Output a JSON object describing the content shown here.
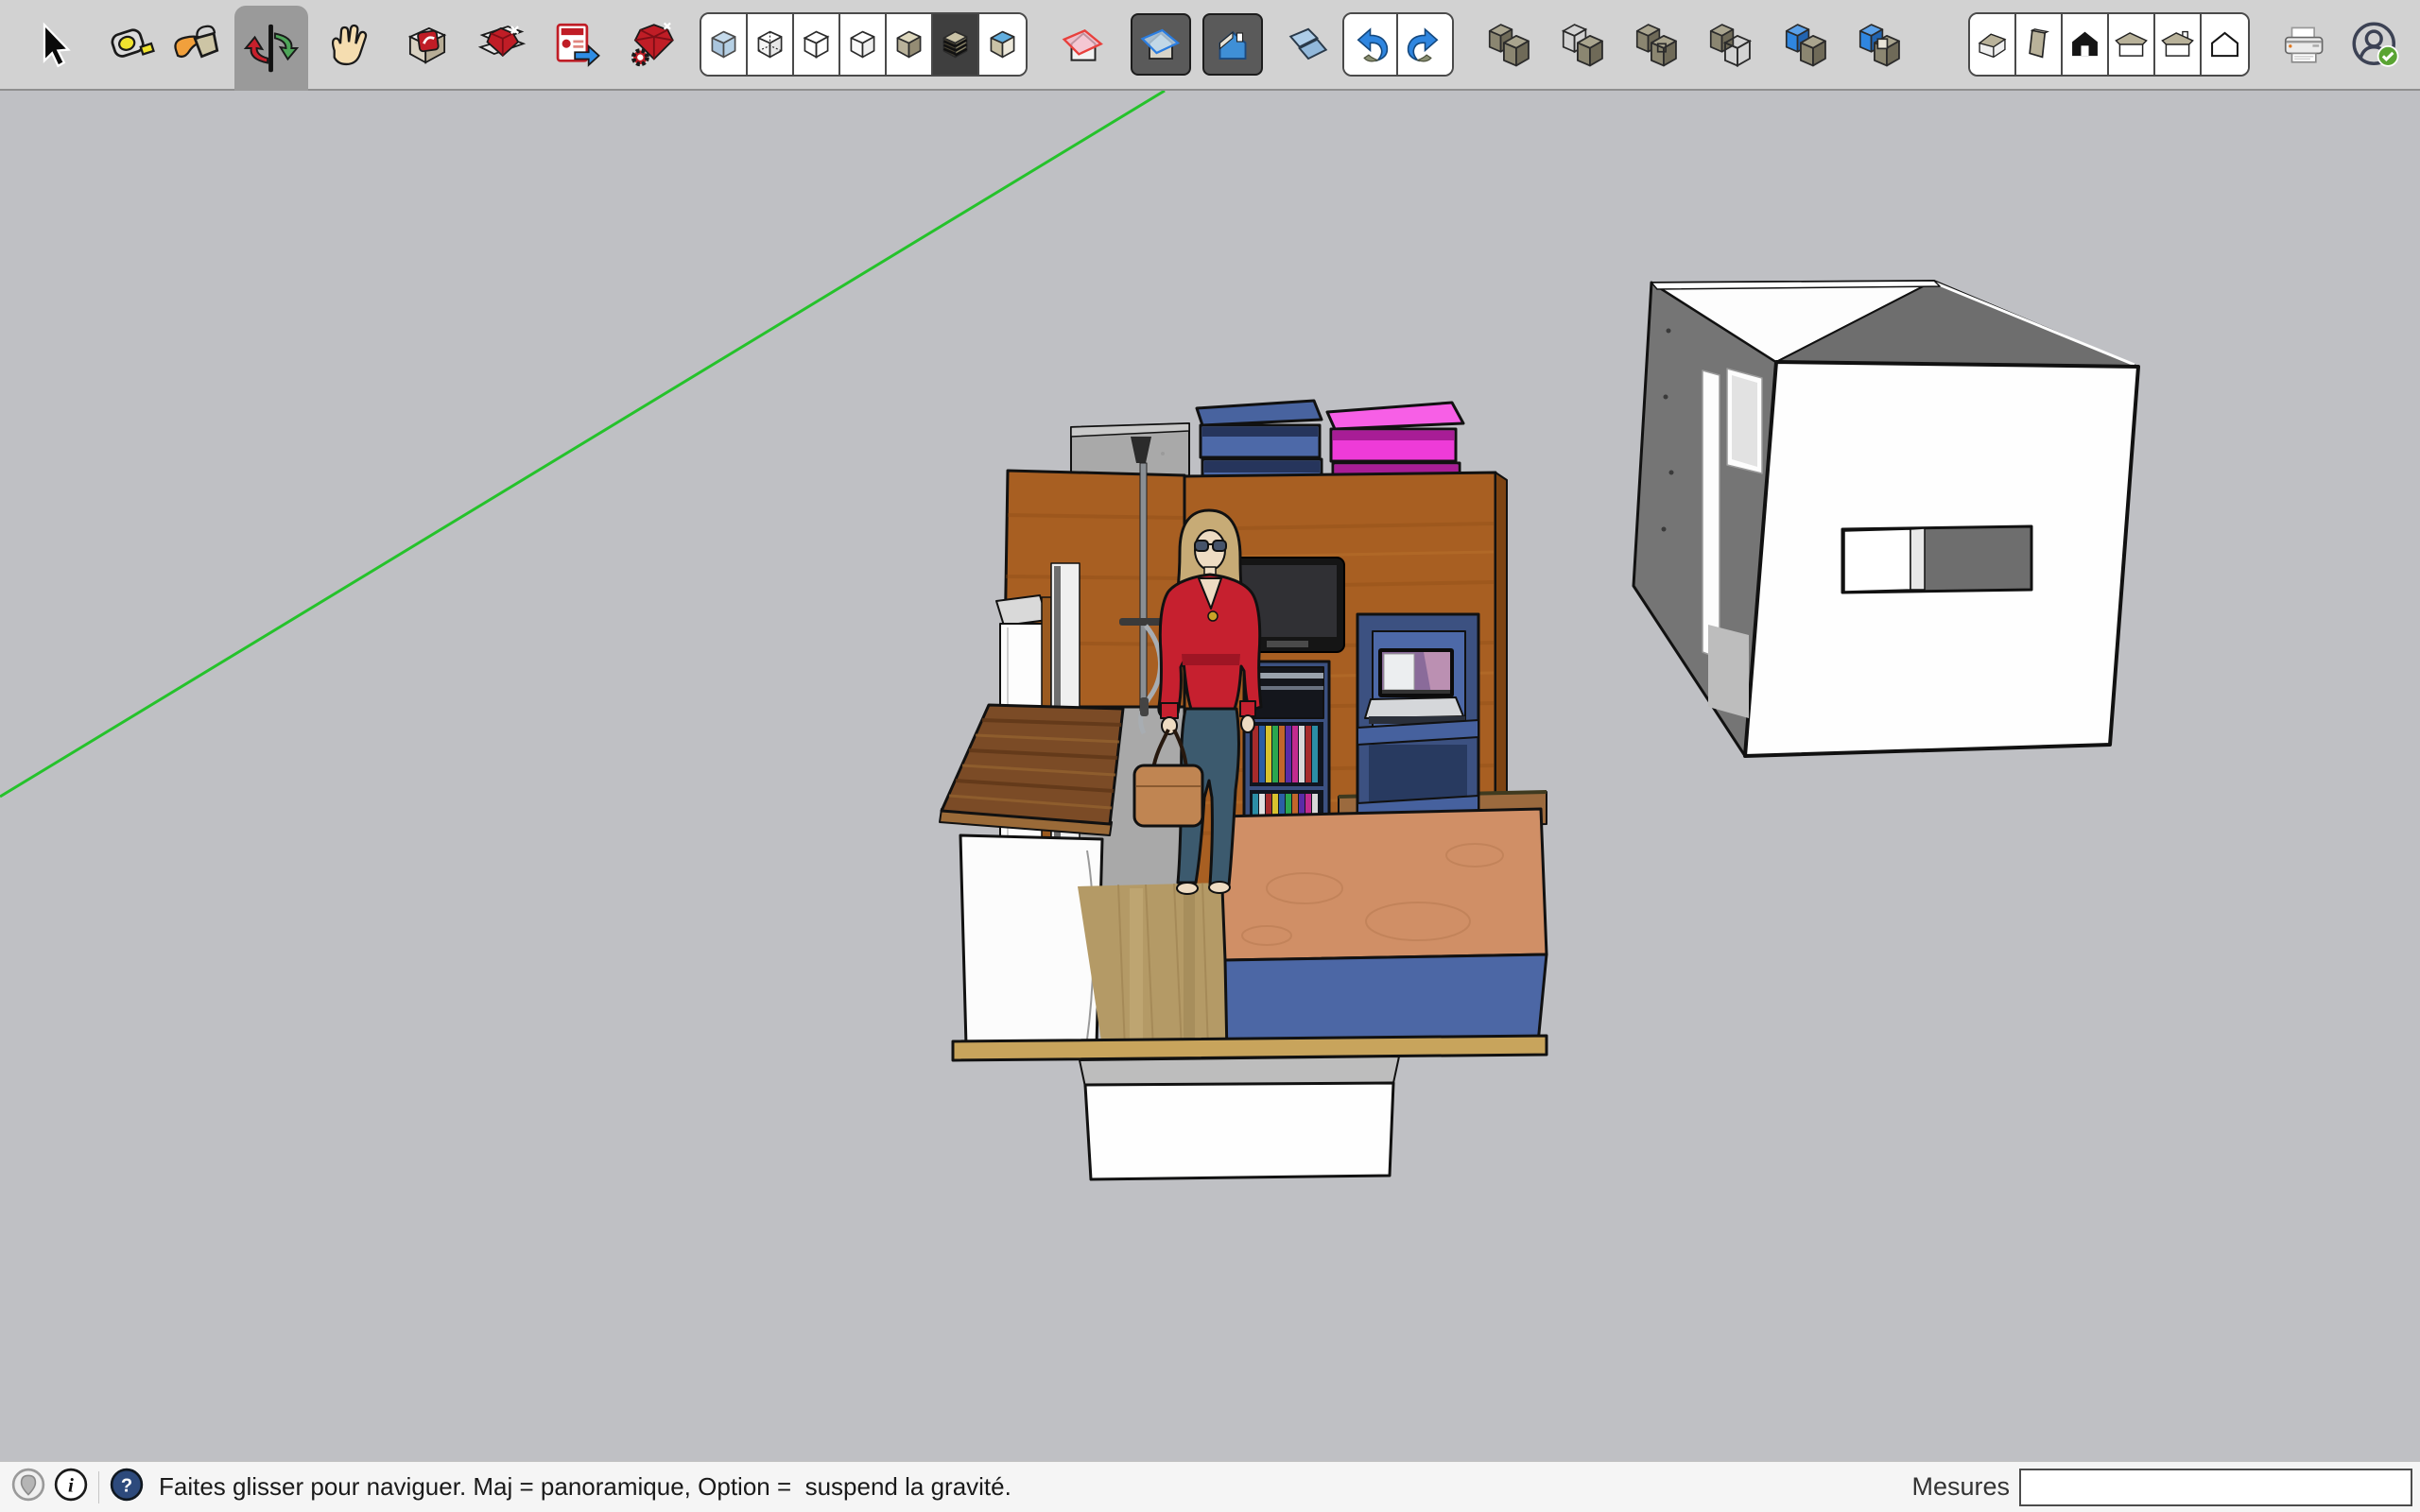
{
  "app": {
    "name": "SketchUp"
  },
  "colors": {
    "canvas": "#bfc0c4",
    "toolbar": "#d2d2d2",
    "green_axis": "#25c22b",
    "wood": "#a85f22",
    "wood_dark": "#7d4413",
    "gray_wall": "#a9a9a9",
    "navy": "#3c5181",
    "navy_light": "#4d69a8",
    "navy_dark": "#283a60",
    "pink": "#ee3bd8",
    "pink_top": "#f75fe6",
    "pink_dark": "#a81d96",
    "hair": "#c7ab76",
    "skin": "#eedcc3",
    "red_top": "#c6202f",
    "red_dark": "#9e1524",
    "jeans": "#3c5a6e",
    "bag": "#c08552",
    "counter_wood": "#7b4b26",
    "floor_wood": "#b49a66",
    "bed_wood": "#d08f66",
    "bed_blue": "#4c67a5",
    "base_plate": "#c8a45c",
    "shell_dark": "#757575",
    "screen_purple": "#8a6b9a"
  },
  "toolbar": {
    "items": [
      {
        "id": "select-tool",
        "icon": "cursor",
        "active": false
      },
      {
        "id": "tape-measure-tool",
        "icon": "tape",
        "active": false
      },
      {
        "id": "paint-bucket-tool",
        "icon": "bucket",
        "active": false
      },
      {
        "id": "orbit-tool",
        "icon": "orbit",
        "active": true
      },
      {
        "id": "pan-tool",
        "icon": "hand",
        "active": false
      },
      {
        "id": "sketchup-component-tool",
        "icon": "subox",
        "active": false
      },
      {
        "id": "sketchup-gem-page-tool",
        "icon": "sugem",
        "active": false
      },
      {
        "id": "sketchup-export-tool",
        "icon": "suexport",
        "active": false
      },
      {
        "id": "sketchup-gem-gear-tool",
        "icon": "sugear",
        "active": false
      },
      {
        "id": "face-style-group",
        "items": [
          {
            "id": "style-xray",
            "icon": "xray",
            "active": false
          },
          {
            "id": "style-back-edges",
            "icon": "backedges",
            "active": false
          },
          {
            "id": "style-wireframe",
            "icon": "wireframe",
            "active": false
          },
          {
            "id": "style-hidden-line",
            "icon": "hiddenline",
            "active": false
          },
          {
            "id": "style-shaded",
            "icon": "shaded",
            "active": false
          },
          {
            "id": "style-shaded-textures",
            "icon": "textures",
            "active": true
          },
          {
            "id": "style-monochrome",
            "icon": "mono",
            "active": false
          }
        ]
      },
      {
        "id": "section-plane-tool",
        "icon": "sectionred",
        "active": false
      },
      {
        "id": "display-section-planes-toggle",
        "icon": "sectionplanes",
        "active": true
      },
      {
        "id": "display-section-cuts-toggle",
        "icon": "sectioncuts",
        "active": true
      },
      {
        "id": "section-fill-toggle",
        "icon": "sectionfill",
        "active": false
      },
      {
        "id": "history-group",
        "items": [
          {
            "id": "undo-button",
            "icon": "undo",
            "active": false
          },
          {
            "id": "redo-button",
            "icon": "redo",
            "active": false
          }
        ]
      },
      {
        "id": "solid-outer-shell-tool",
        "icon": "solidshell",
        "active": false
      },
      {
        "id": "solid-intersect-tool",
        "icon": "solidintersect",
        "active": false
      },
      {
        "id": "solid-union-tool",
        "icon": "solidunion",
        "active": false
      },
      {
        "id": "solid-subtract-tool",
        "icon": "solidsubtract",
        "active": false
      },
      {
        "id": "solid-trim-tool",
        "icon": "solidtrim",
        "active": false
      },
      {
        "id": "solid-split-tool",
        "icon": "solidsplit",
        "active": false
      },
      {
        "id": "views-group",
        "items": [
          {
            "id": "view-iso",
            "icon": "viewiso",
            "active": false
          },
          {
            "id": "view-top",
            "icon": "viewtop",
            "active": false
          },
          {
            "id": "view-front",
            "icon": "viewfront",
            "active": false
          },
          {
            "id": "view-right",
            "icon": "viewright",
            "active": false
          },
          {
            "id": "view-back",
            "icon": "viewback",
            "active": false
          },
          {
            "id": "view-left",
            "icon": "viewleft",
            "active": false
          }
        ]
      },
      {
        "id": "print-button",
        "icon": "print",
        "active": false
      },
      {
        "id": "account-button",
        "icon": "account",
        "active": false
      }
    ]
  },
  "statusbar": {
    "icons": [
      {
        "id": "geolocation-icon"
      },
      {
        "id": "info-icon"
      },
      {
        "id": "help-icon"
      }
    ],
    "message": "Faites glisser pour naviguer. Maj = panoramique, Option =  suspend la gravité.",
    "measurements_label": "Mesures",
    "measurements_value": ""
  }
}
